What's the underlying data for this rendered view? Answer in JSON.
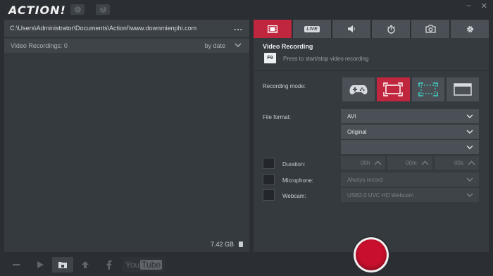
{
  "app": {
    "logo_text": "ACTION!",
    "info_icon": "info-icon",
    "help_icon": "help-icon",
    "window_controls": {
      "minimize": "–",
      "close": "✕"
    }
  },
  "left": {
    "path": "C:\\Users\\Administrator\\Documents\\Action!\\www.downmienphi.com",
    "more_label": "...",
    "recordings_label": "Video Recordings: 0",
    "sort_label": "by date",
    "disk_free": "7.42 GB"
  },
  "bottom_toolbar": {
    "youtube_label_a": "You",
    "youtube_label_b": "Tube",
    "icons": [
      "delete-icon",
      "play-icon",
      "folder-icon",
      "upload-icon",
      "facebook-icon",
      "youtube-icon"
    ]
  },
  "right": {
    "tabs": [
      {
        "name": "video-recording-tab",
        "icon": "film-icon",
        "selected": true
      },
      {
        "name": "live-tab",
        "label": "LIVE",
        "selected": false
      },
      {
        "name": "audio-tab",
        "icon": "speaker-icon",
        "selected": false
      },
      {
        "name": "benchmark-tab",
        "icon": "stopwatch-icon",
        "selected": false
      },
      {
        "name": "screenshot-tab",
        "icon": "camera-icon",
        "selected": false
      },
      {
        "name": "settings-tab",
        "icon": "gear-icon",
        "selected": false
      }
    ],
    "section_title": "Video Recording",
    "hotkey": "F9",
    "hotkey_desc": "Press to start/stop video recording",
    "recording_mode_label": "Recording mode:",
    "modes": [
      "game-mode",
      "active-screen-mode",
      "region-mode",
      "window-mode"
    ],
    "selected_mode": "active-screen-mode",
    "file_format_label": "File format:",
    "file_format_value": "AVI",
    "quality_value": "Original",
    "extra_value": "",
    "duration_label": "Duration:",
    "duration": {
      "hours": "00h",
      "minutes": "00m",
      "seconds": "00s"
    },
    "microphone_label": "Microphone:",
    "microphone_value": "Always record",
    "webcam_label": "Webcam:",
    "webcam_value": "USB2.0 UVC HD Webcam"
  },
  "colors": {
    "accent": "#c0263e",
    "record": "#c8102e",
    "panel": "#353a3f",
    "background": "#2b2f33"
  }
}
